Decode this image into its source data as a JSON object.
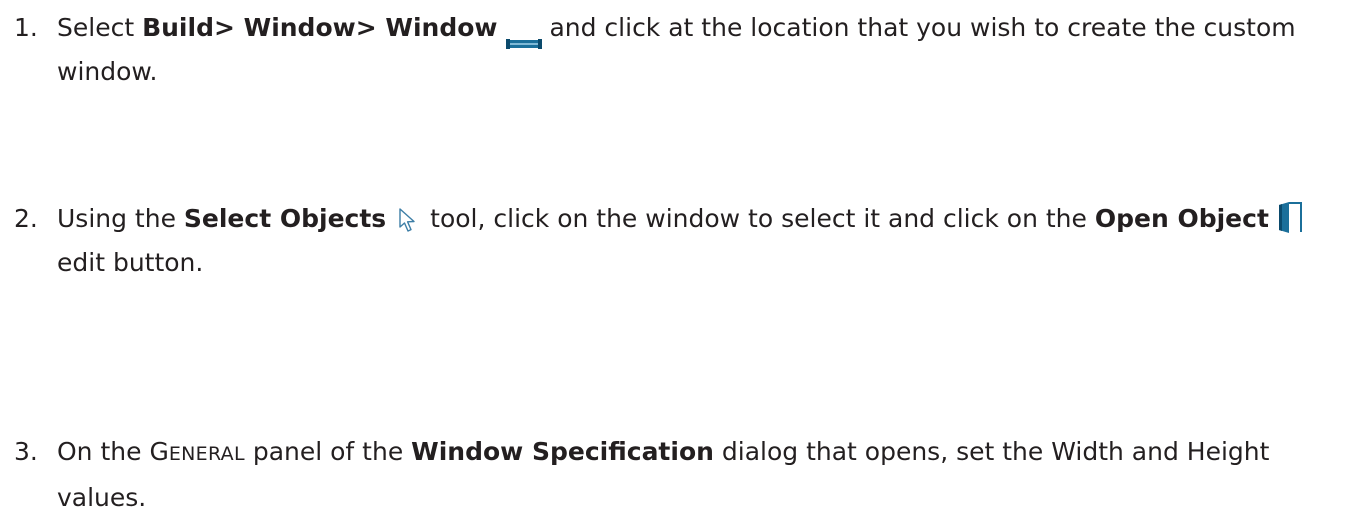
{
  "steps": [
    {
      "number": "1.",
      "parts": {
        "a": "Select ",
        "menu_path": "Build> Window> Window",
        "b": " and click at the location that you wish to create the custom window."
      },
      "icon": "window-tool-icon"
    },
    {
      "number": "2.",
      "parts": {
        "a": "Using the ",
        "tool": "Select Objects",
        "b": " tool, click on the window to select it and click on the ",
        "button": "Open Object",
        "c": " edit button."
      },
      "icons": [
        "select-arrow-icon",
        "open-object-icon"
      ]
    },
    {
      "number": "3.",
      "parts": {
        "a": "On the ",
        "panel_first": "G",
        "panel_rest": "ENERAL",
        "b": " panel of the ",
        "dialog": "Window Specification",
        "c": " dialog that opens, set the Width and Height values."
      }
    }
  ],
  "colors": {
    "text": "#231f20",
    "icon_blue": "#1b6f9a",
    "icon_dark": "#0b4a6c"
  }
}
